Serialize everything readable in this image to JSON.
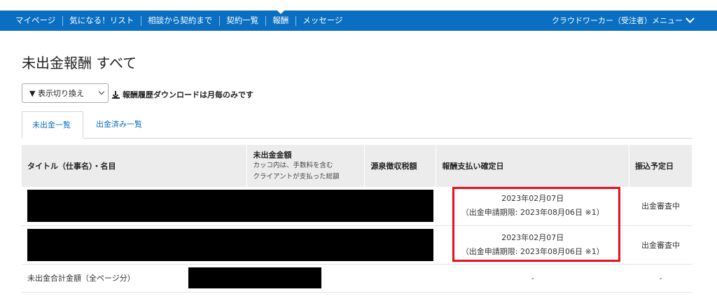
{
  "nav": {
    "items": [
      "マイページ",
      "気になる！リスト",
      "相談から契約まで",
      "契約一覧",
      "報酬",
      "メッセージ"
    ],
    "active_index": 4,
    "menu_label": "クラウドワーカー（受注者）メニュー",
    "color": "#0a6fc2"
  },
  "page": {
    "title": "未出金報酬 すべて"
  },
  "toolbar": {
    "switch_label": "▼ 表示切り換え",
    "download_text": "報酬履歴ダウンロードは月毎のみです"
  },
  "tabs": [
    {
      "label": "未出金一覧",
      "active": true
    },
    {
      "label": "出金済み一覧",
      "active": false
    }
  ],
  "table": {
    "headers": {
      "title": "タイトル（仕事名）・名目",
      "amount": "未出金金額",
      "amount_note1": "カッコ内は、手数料を含む",
      "amount_note2": "クライアントが支払った総額",
      "tax": "源泉徴収税額",
      "confirm": "報酬支払い確定日",
      "transfer": "振込予定日"
    },
    "rows": [
      {
        "confirm_date": "2023年02月07日",
        "deadline": "（出金申請期限: 2023年08月06日 ※1）",
        "status": "出金審査中"
      },
      {
        "confirm_date": "2023年02月07日",
        "deadline": "（出金申請期限: 2023年08月06日 ※1）",
        "status": "出金審査中"
      }
    ],
    "total": {
      "label": "未出金合計金額（全ページ分）",
      "confirm": "-",
      "transfer": "-"
    }
  },
  "highlight_color": "#e8101c"
}
